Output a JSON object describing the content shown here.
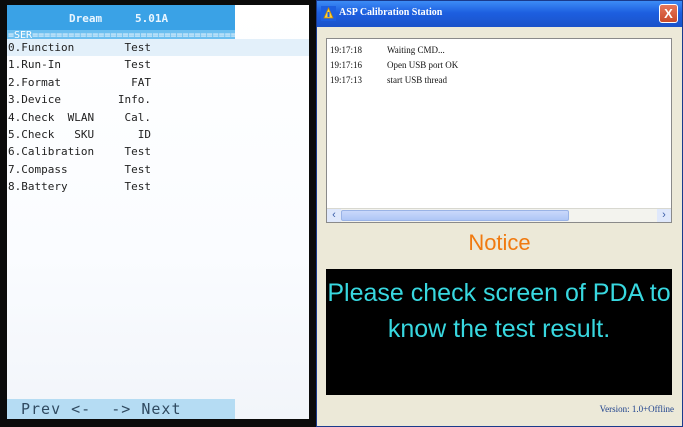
{
  "pda": {
    "model": "Dream",
    "version": "5.01A",
    "separator": "=SER===================================",
    "menu": [
      {
        "label": "0.Function",
        "value": "Test"
      },
      {
        "label": "1.Run-In",
        "value": "Test"
      },
      {
        "label": "2.Format",
        "value": "FAT"
      },
      {
        "label": "3.Device",
        "value": "Info."
      },
      {
        "label": "4.Check  WLAN",
        "value": "Cal."
      },
      {
        "label": "5.Check   SKU",
        "value": "ID"
      },
      {
        "label": "6.Calibration",
        "value": "Test"
      },
      {
        "label": "7.Compass",
        "value": "Test"
      },
      {
        "label": "8.Battery",
        "value": "Test"
      }
    ],
    "footer": "Prev <-  -> Next"
  },
  "window": {
    "title": "ASP Calibration Station",
    "close_label": "X",
    "log": [
      {
        "time": "19:17:18",
        "message": "Waiting CMD..."
      },
      {
        "time": "19:17:16",
        "message": "Open USB port OK"
      },
      {
        "time": "19:17:13",
        "message": "start USB thread"
      }
    ],
    "notice": "Notice",
    "result_line1": "Please check screen of PDA to",
    "result_line2": "know the test result.",
    "version": "Version: 1.0+Offline"
  }
}
